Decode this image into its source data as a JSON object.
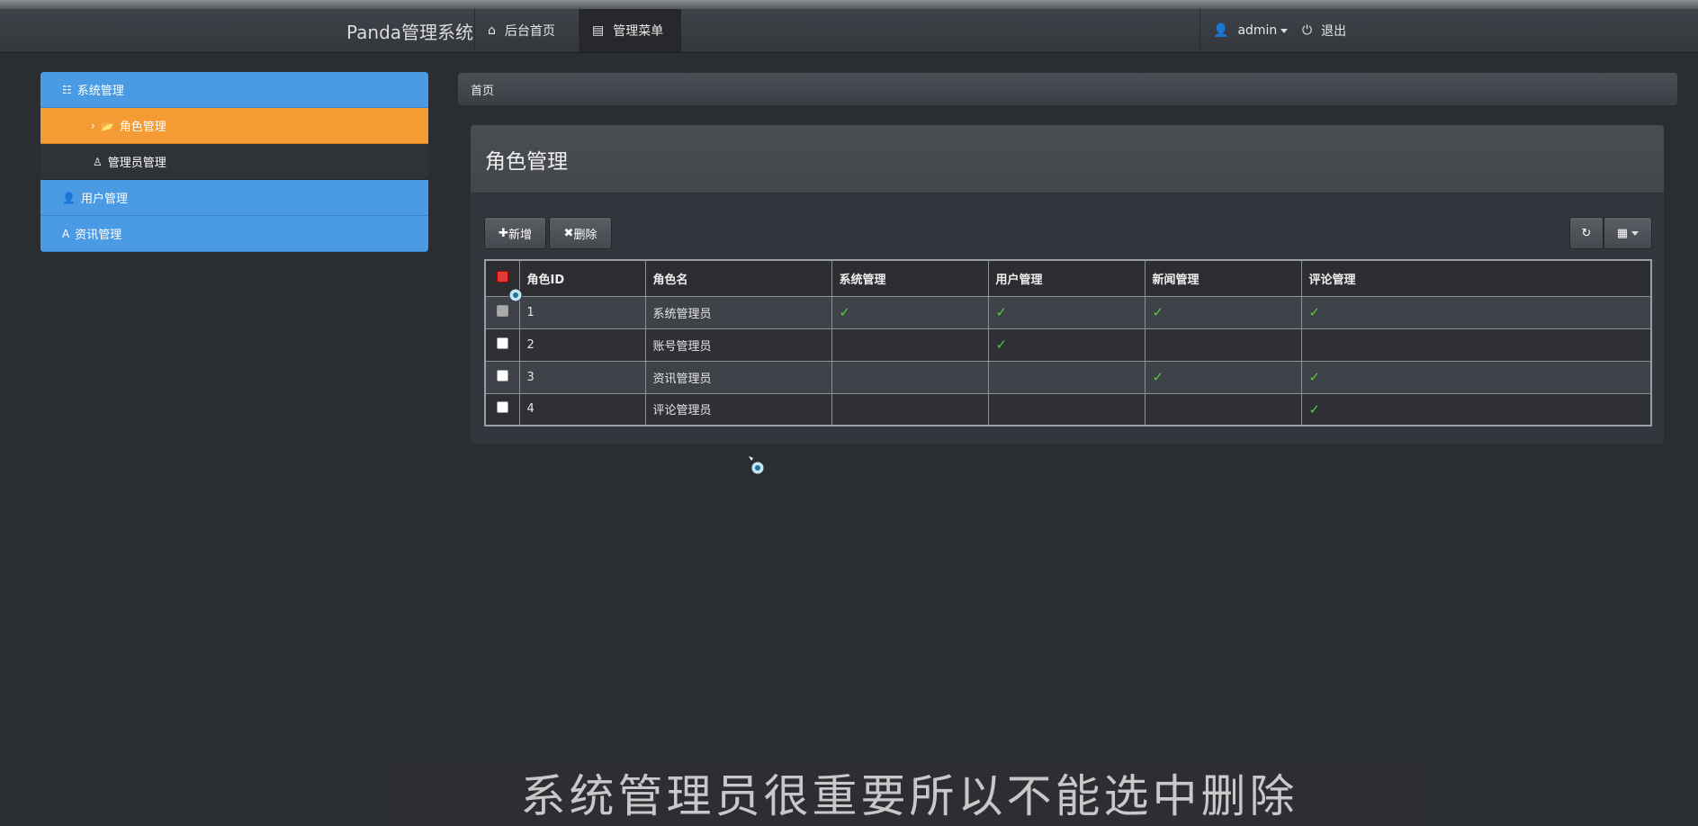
{
  "navbar": {
    "brand": "Panda管理系统",
    "home_label": "后台首页",
    "menu_label": "管理菜单",
    "user_label": "admin",
    "logout_label": "退出"
  },
  "sidebar": {
    "items": [
      {
        "label": "系统管理",
        "type": "group"
      },
      {
        "label": "角色管理",
        "type": "sub",
        "active": true
      },
      {
        "label": "管理员管理",
        "type": "sub"
      },
      {
        "label": "用户管理",
        "type": "group"
      },
      {
        "label": "资讯管理",
        "type": "group"
      }
    ]
  },
  "breadcrumb": "首页",
  "panel": {
    "title": "角色管理",
    "add_label": "新增",
    "delete_label": "删除"
  },
  "table": {
    "headers": [
      "角色ID",
      "角色名",
      "系统管理",
      "用户管理",
      "新闻管理",
      "评论管理"
    ],
    "rows": [
      {
        "id": "1",
        "name": "系统管理员",
        "perms": [
          true,
          true,
          true,
          true
        ],
        "disabled": true
      },
      {
        "id": "2",
        "name": "账号管理员",
        "perms": [
          false,
          true,
          false,
          false
        ]
      },
      {
        "id": "3",
        "name": "资讯管理员",
        "perms": [
          false,
          false,
          true,
          true
        ]
      },
      {
        "id": "4",
        "name": "评论管理员",
        "perms": [
          false,
          false,
          false,
          true
        ]
      }
    ],
    "check_glyph": "✓"
  },
  "subtitle": "系统管理员很重要所以不能选中删除",
  "colors": {
    "accent": "#4a9be4",
    "active": "#f59b34",
    "check": "#4ccf3c"
  }
}
